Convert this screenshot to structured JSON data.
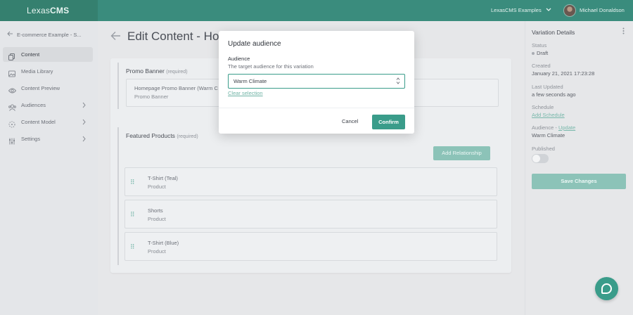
{
  "topbar": {
    "brand_prefix": "Lexas",
    "brand_suffix": "CMS",
    "project": "LexasCMS Examples",
    "user": "Michael Donaldson"
  },
  "sidebar": {
    "back_label": "E-commerce Example - S...",
    "items": [
      {
        "label": "Content",
        "icon": "content-icon",
        "active": true
      },
      {
        "label": "Media Library",
        "icon": "image-icon"
      },
      {
        "label": "Content Preview",
        "icon": "eye-icon"
      },
      {
        "label": "Audiences",
        "icon": "users-icon",
        "expandable": true
      },
      {
        "label": "Content Model",
        "icon": "model-icon",
        "expandable": true
      },
      {
        "label": "Settings",
        "icon": "sliders-icon",
        "expandable": true
      }
    ]
  },
  "main": {
    "title": "Edit Content - Ho",
    "promo": {
      "label": "Promo Banner",
      "required": "(required)",
      "ref_title": "Homepage Promo Banner (Warm C",
      "ref_type": "Promo Banner"
    },
    "featured": {
      "label": "Featured Products",
      "required": "(required)",
      "add_button": "Add Relationship",
      "products": [
        {
          "name": "T-Shirt (Teal)",
          "type": "Product"
        },
        {
          "name": "Shorts",
          "type": "Product"
        },
        {
          "name": "T-Shirt (Blue)",
          "type": "Product"
        }
      ]
    }
  },
  "details": {
    "title": "Variation Details",
    "status_label": "Status",
    "status_value": "Draft",
    "created_label": "Created",
    "created_value": "January 21, 2021 17:23:28",
    "updated_label": "Last Updated",
    "updated_value": "a few seconds ago",
    "schedule_label": "Schedule",
    "schedule_link": "Add Schedule",
    "audience_label": "Audience - ",
    "audience_link": "Update",
    "audience_value": "Warm Climate",
    "published_label": "Published",
    "save_button": "Save Changes"
  },
  "modal": {
    "title": "Update audience",
    "field_label": "Audience",
    "field_help": "The target audience for this variation",
    "selected": "Warm Climate",
    "clear": "Clear selection",
    "cancel": "Cancel",
    "confirm": "Confirm"
  },
  "colors": {
    "accent": "#3a9c8a",
    "topbar": "#3a8c7d",
    "accent_muted": "#8cc3b8"
  }
}
